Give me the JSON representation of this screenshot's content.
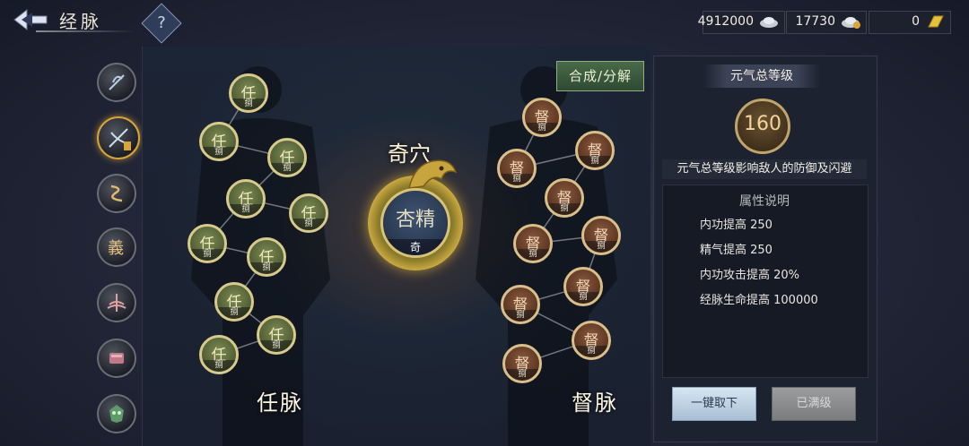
{
  "header": {
    "title": "经脉",
    "help_label": "?"
  },
  "currencies": [
    {
      "value": "4912000",
      "icon": "silver-ingot-icon"
    },
    {
      "value": "17730",
      "icon": "bound-silver-icon"
    },
    {
      "value": "0",
      "icon": "gold-icon"
    }
  ],
  "sidebar": {
    "items": [
      {
        "icon": "blade-crest-icon",
        "selected": false
      },
      {
        "icon": "sword-crest-icon",
        "selected": true
      },
      {
        "icon": "serpent-glyph-icon",
        "selected": false
      },
      {
        "icon": "yi-glyph-icon",
        "selected": false
      },
      {
        "icon": "lotus-blade-icon",
        "selected": false
      },
      {
        "icon": "armor-icon",
        "selected": false
      },
      {
        "icon": "demon-mask-icon",
        "selected": false
      }
    ]
  },
  "main": {
    "synth_button": "合成/分解",
    "qixue_title": "奇穴",
    "center_node": {
      "glyph": "杏精",
      "sub": "奇"
    },
    "ren": {
      "label": "任脉",
      "node_glyph": "任",
      "node_sub": "捌"
    },
    "du": {
      "label": "督脉",
      "node_glyph": "督",
      "node_sub": "捌"
    }
  },
  "right_panel": {
    "level_tab": "元气总等级",
    "level_value": "160",
    "level_desc": "元气总等级影响敌人的防御及闪避",
    "attr_title": "属性说明",
    "attrs": [
      "内功提高  250",
      "精气提高  250",
      "内功攻击提高  20%",
      "经脉生命提高  100000"
    ],
    "btn_remove": "一键取下",
    "btn_maxed": "已满级"
  },
  "colors": {
    "accent_gold": "#d8c98c",
    "ren_node": "#5b6a3c",
    "du_node": "#6e4228",
    "panel_bg": "#1d2230"
  }
}
